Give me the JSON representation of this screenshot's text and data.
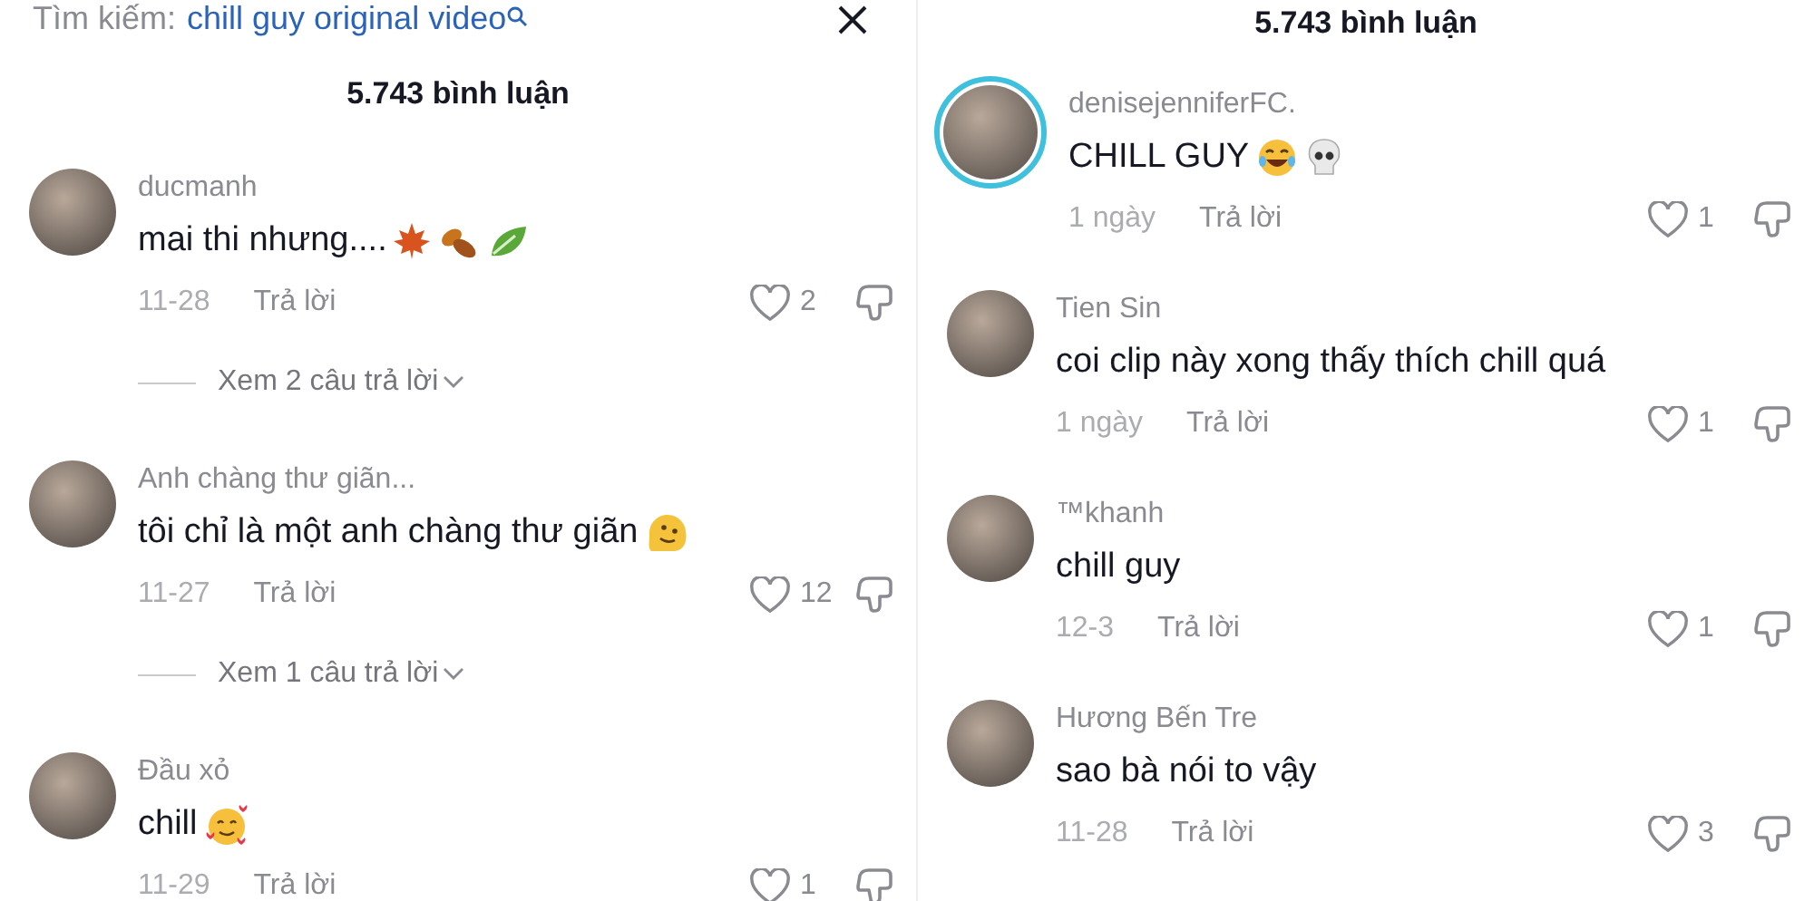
{
  "panels": [
    {
      "search": {
        "label": "Tìm kiếm:",
        "query": "chill guy original video"
      },
      "comment_count": "5.743 bình luận",
      "comments": [
        {
          "username": "ducmanh",
          "text": "mai thi nhưng....",
          "date": "11-28",
          "reply_label": "Trả lời",
          "likes": "2",
          "story_ring": false,
          "replies_label": "Xem 2 câu trả lời"
        },
        {
          "username": "Anh chàng thư giãn...",
          "text": "tôi chỉ là một anh chàng thư giãn",
          "date": "11-27",
          "reply_label": "Trả lời",
          "likes": "12",
          "story_ring": false,
          "replies_label": "Xem 1 câu trả lời"
        },
        {
          "username": "Đầu xỏ",
          "text": "chill",
          "date": "11-29",
          "reply_label": "Trả lời",
          "likes": "1",
          "story_ring": false
        }
      ]
    },
    {
      "comment_count": "5.743 bình luận",
      "comments": [
        {
          "username": "denisejenniferFC.",
          "text": "CHILL GUY",
          "date": "1 ngày",
          "reply_label": "Trả lời",
          "likes": "1",
          "story_ring": true
        },
        {
          "username": "Tien Sin",
          "text": "coi clip này xong thấy thích chill quá",
          "date": "1 ngày",
          "reply_label": "Trả lời",
          "likes": "1",
          "story_ring": false
        },
        {
          "username": "™khanh",
          "text": "chill guy",
          "date": "12-3",
          "reply_label": "Trả lời",
          "likes": "1",
          "story_ring": false
        },
        {
          "username": "Hương Bến Tre",
          "text": "sao bà nói to vậy",
          "date": "11-28",
          "reply_label": "Trả lời",
          "likes": "3",
          "story_ring": false
        }
      ]
    }
  ]
}
